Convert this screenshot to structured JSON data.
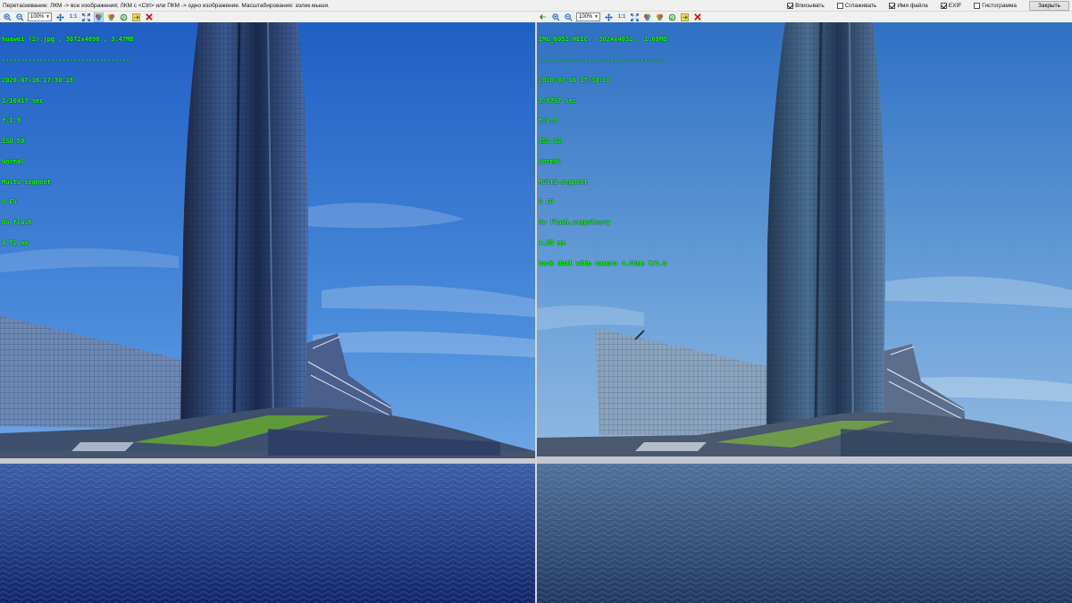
{
  "hint_bar": {
    "text": "Перетаскивание: ЛКМ -> все изображения; ЛКМ с <Ctrl> или ПКМ -> одно изображение. Масштабирование: зо­лик мыши."
  },
  "options": [
    {
      "label": "Вписывать",
      "checked": true
    },
    {
      "label": "Сглаживать",
      "checked": false
    },
    {
      "label": "Имя файла",
      "checked": true
    },
    {
      "label": "EXIF",
      "checked": true
    },
    {
      "label": "Гистограмма",
      "checked": false
    }
  ],
  "close_label": "Закрыть",
  "toolbar": {
    "zoom_value": "100%",
    "actual_size_label": "1:1"
  },
  "icons": {
    "zoom_in": "zoom-in-icon",
    "zoom_out": "zoom-out-icon",
    "pan": "pan-icon",
    "fit": "fit-screen-icon",
    "color_a": "color-wheel-icon",
    "color_b": "palette-icon",
    "next": "next-green-icon",
    "remove": "remove-red-x-icon",
    "prev": "prev-green-arrow-icon"
  },
  "colors": {
    "exif_text": "#19ff19",
    "remove_icon": "#d40000",
    "accent": "#2a6fc9"
  },
  "left_image": {
    "filename_line": "huawei (2).jpg , 3072x4096 , 3.47MB",
    "separator": "----------------------------------",
    "datetime": "2020-07-16 17:30:18",
    "exposure": "1/10417 sec",
    "aperture": "f/1.8",
    "iso": "ISO 50",
    "mode": "Normal",
    "metering": "Multi-segment",
    "ev": "0 EV",
    "flash": "No flash",
    "focal": "4.71 mm",
    "lens": ""
  },
  "right_image": {
    "filename_line": "IMG_6052.HEIC , 3024x4032 , 1.68MB",
    "separator": "----------------------------------",
    "datetime": "2020-07-16 17:30:16",
    "exposure": "1/5757 sec",
    "aperture": "f/1.8",
    "iso": "ISO 32",
    "mode": "Normal",
    "metering": "Multi-segment",
    "ev": "0 EV",
    "flash": "No flash,compulsory",
    "focal": "4.25 mm",
    "lens": "back dual wide camera 4.25mm f/1.8"
  }
}
